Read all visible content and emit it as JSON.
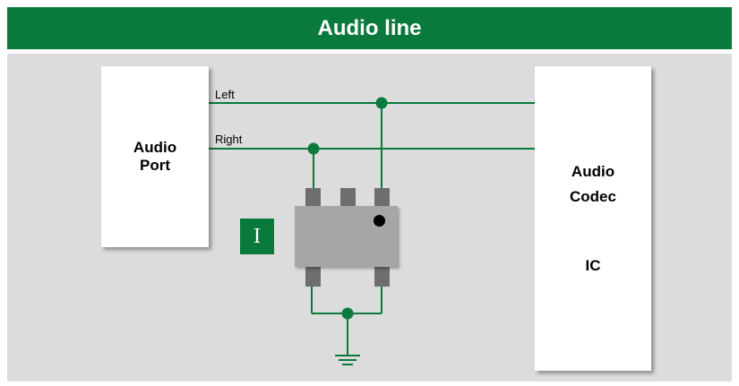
{
  "header": {
    "title": "Audio line"
  },
  "audio_port": {
    "line1": "Audio",
    "line2": "Port"
  },
  "codec": {
    "line1": "Audio",
    "line2": "Codec",
    "line3": "IC"
  },
  "wires": {
    "left_label": "Left",
    "right_label": "Right"
  },
  "badge": {
    "text": "I"
  },
  "colors": {
    "accent": "#0a7a3c",
    "panel": "#dcdcdc",
    "chip": "#a6a6a6",
    "pin": "#6e6e6e"
  }
}
